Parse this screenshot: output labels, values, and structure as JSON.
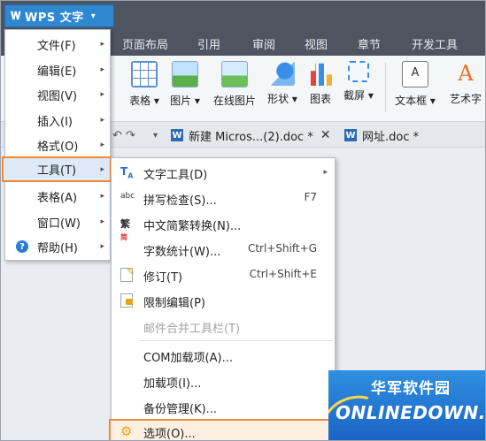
{
  "app": {
    "title": "WPS 文字"
  },
  "menu_tabs": [
    "页面布局",
    "引用",
    "审阅",
    "视图",
    "章节",
    "开发工具"
  ],
  "ribbon": {
    "buttons": [
      {
        "label": "表格",
        "icon": "table-icon",
        "dropdown": true
      },
      {
        "label": "图片",
        "icon": "picture-icon",
        "dropdown": true
      },
      {
        "label": "在线图片",
        "icon": "online-picture-icon",
        "dropdown": false
      },
      {
        "label": "形状",
        "icon": "shape-icon",
        "dropdown": true
      },
      {
        "label": "图表",
        "icon": "chart-icon",
        "dropdown": false
      },
      {
        "label": "截屏",
        "icon": "screenshot-icon",
        "dropdown": true
      },
      {
        "label": "文本框",
        "icon": "textbox-icon",
        "dropdown": true
      },
      {
        "label": "艺术字",
        "icon": "wordart-icon",
        "dropdown": false
      }
    ]
  },
  "doc_tabs": [
    {
      "title": "新建 Micros...(2).doc *",
      "closable": true
    },
    {
      "title": "网址.doc *",
      "closable": false
    }
  ],
  "left_menu": {
    "items": [
      {
        "label": "文件(F)",
        "has_submenu": true
      },
      {
        "label": "编辑(E)",
        "has_submenu": true
      },
      {
        "label": "视图(V)",
        "has_submenu": true
      },
      {
        "label": "插入(I)",
        "has_submenu": true
      },
      {
        "label": "格式(O)",
        "has_submenu": true
      },
      {
        "label": "工具(T)",
        "has_submenu": true,
        "selected": true
      },
      {
        "label": "表格(A)",
        "has_submenu": true
      },
      {
        "label": "窗口(W)",
        "has_submenu": true
      },
      {
        "label": "帮助(H)",
        "has_submenu": true,
        "icon": "help-icon"
      }
    ]
  },
  "tools_submenu": {
    "items": [
      {
        "label": "文字工具(D)",
        "shortcut": "",
        "has_submenu": true,
        "icon": "text-tools-icon"
      },
      {
        "label": "拼写检查(S)...",
        "shortcut": "F7",
        "icon": "spellcheck-icon"
      },
      {
        "label": "中文简繁转换(N)...",
        "shortcut": "",
        "icon": "chinese-convert-icon"
      },
      {
        "label": "字数统计(W)...",
        "shortcut": "Ctrl+Shift+G"
      },
      {
        "label": "修订(T)",
        "shortcut": "Ctrl+Shift+E",
        "icon": "revision-icon"
      },
      {
        "label": "限制编辑(P)",
        "shortcut": "",
        "icon": "lock-icon"
      },
      {
        "label": "邮件合并工具栏(T)",
        "shortcut": "",
        "disabled": true
      },
      {
        "label": "COM加载项(A)...",
        "shortcut": ""
      },
      {
        "label": "加载项(I)...",
        "shortcut": ""
      },
      {
        "label": "备份管理(K)...",
        "shortcut": ""
      },
      {
        "label": "选项(O)...",
        "shortcut": "",
        "selected": true,
        "icon": "gear-icon"
      }
    ]
  },
  "watermark": {
    "cn": "华军软件园",
    "en": "ONLINEDOWN.NET"
  },
  "colors": {
    "accent": "#f0883a",
    "titlebar": "#4d5561",
    "wps_blue": "#2f88cf"
  }
}
